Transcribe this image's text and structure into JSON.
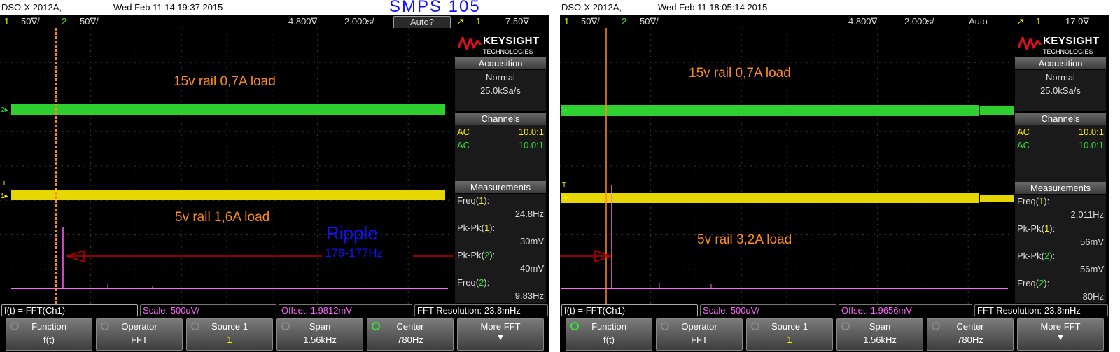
{
  "page_title": "SMPS 105",
  "ripple_annotation": {
    "title": "Ripple",
    "freq": "176-177Hz"
  },
  "colors": {
    "ch1": "#ffee00",
    "ch2": "#33e633",
    "math": "#ff66ff",
    "cursor": "#ff8c1a",
    "annotation": "#1010ff"
  },
  "scopes": [
    {
      "model": "DSO-X 2012A,",
      "timestamp": "Wed Feb 11 14:19:37 2015",
      "status": {
        "ch1_num": "1",
        "ch1_scale": "50∇/",
        "ch2_num": "2",
        "ch2_scale": "50∇/",
        "time_pos": "4.800∇",
        "time_scale": "2.000s/",
        "trigger_mode": "Auto?",
        "trig_ch": "1",
        "trig_level": "7.50∇"
      },
      "labels": {
        "rail15": "15v rail 0,7A load",
        "rail5": "5v rail 1,6A load"
      },
      "markers": {
        "ch2": "2▸",
        "ch1": "1▸",
        "trig": "T"
      },
      "sidebar": {
        "brand": "KEYSIGHT",
        "brand_sub": "TECHNOLOGIES",
        "acquisition_title": "Acquisition",
        "acq_mode": "Normal",
        "acq_rate": "25.0kSa/s",
        "channels_title": "Channels",
        "ch1_coupling": "AC",
        "ch1_probe": "10.0:1",
        "ch2_coupling": "AC",
        "ch2_probe": "10.0:1",
        "measurements_title": "Measurements",
        "m1_name": "Freq(",
        "m1_src": "1",
        "m1_val": "24.8Hz",
        "m2_name": "Pk-Pk(",
        "m2_src": "1",
        "m2_val": "30mV",
        "m3_name": "Pk-Pk(",
        "m3_src": "2",
        "m3_val": "40mV",
        "m4_name": "Freq(",
        "m4_src": "2",
        "m4_val": "9.83Hz"
      },
      "fft": {
        "function": "f(t) = FFT(Ch1)",
        "scale": "Scale: 500uV/",
        "offset": "Offset: 1.9812mV",
        "resolution": "FFT Resolution: 23.8mHz"
      },
      "softkeys": [
        {
          "title": "Function",
          "value": "f(t)"
        },
        {
          "title": "Operator",
          "value": "FFT"
        },
        {
          "title": "Source 1",
          "value": "1"
        },
        {
          "title": "Span",
          "value": "1.56kHz"
        },
        {
          "title": "Center",
          "value": "780Hz"
        },
        {
          "title": "More FFT",
          "value": ""
        }
      ]
    },
    {
      "model": "DSO-X 2012A,",
      "timestamp": "Wed Feb 11 18:05:14 2015",
      "status": {
        "ch1_num": "1",
        "ch1_scale": "50∇/",
        "ch2_num": "2",
        "ch2_scale": "50∇/",
        "time_pos": "4.800∇",
        "time_scale": "2.000s/",
        "trigger_mode": "Auto",
        "trig_ch": "1",
        "trig_level": "17.0∇"
      },
      "labels": {
        "rail15": "15v rail 0,7A load",
        "rail5": "5v rail 3,2A load"
      },
      "markers": {
        "ch2": "2▸",
        "ch1": "1▸",
        "trig": "T"
      },
      "sidebar": {
        "brand": "KEYSIGHT",
        "brand_sub": "TECHNOLOGIES",
        "acquisition_title": "Acquisition",
        "acq_mode": "Normal",
        "acq_rate": "25.0kSa/s",
        "channels_title": "Channels",
        "ch1_coupling": "AC",
        "ch1_probe": "10.0:1",
        "ch2_coupling": "AC",
        "ch2_probe": "10.0:1",
        "measurements_title": "Measurements",
        "m1_name": "Freq(",
        "m1_src": "1",
        "m1_val": "2.011Hz",
        "m2_name": "Pk-Pk(",
        "m2_src": "1",
        "m2_val": "56mV",
        "m3_name": "Pk-Pk(",
        "m3_src": "2",
        "m3_val": "56mV",
        "m4_name": "Freq(",
        "m4_src": "2",
        "m4_val": "80Hz"
      },
      "fft": {
        "function": "f(t) = FFT(Ch1)",
        "scale": "Scale: 500uV/",
        "offset": "Offset: 1.9656mV",
        "resolution": "FFT Resolution: 23.8mHz"
      },
      "softkeys": [
        {
          "title": "Function",
          "value": "f(t)"
        },
        {
          "title": "Operator",
          "value": "FFT"
        },
        {
          "title": "Source 1",
          "value": "1"
        },
        {
          "title": "Span",
          "value": "1.56kHz"
        },
        {
          "title": "Center",
          "value": "780Hz"
        },
        {
          "title": "More FFT",
          "value": ""
        }
      ]
    }
  ]
}
